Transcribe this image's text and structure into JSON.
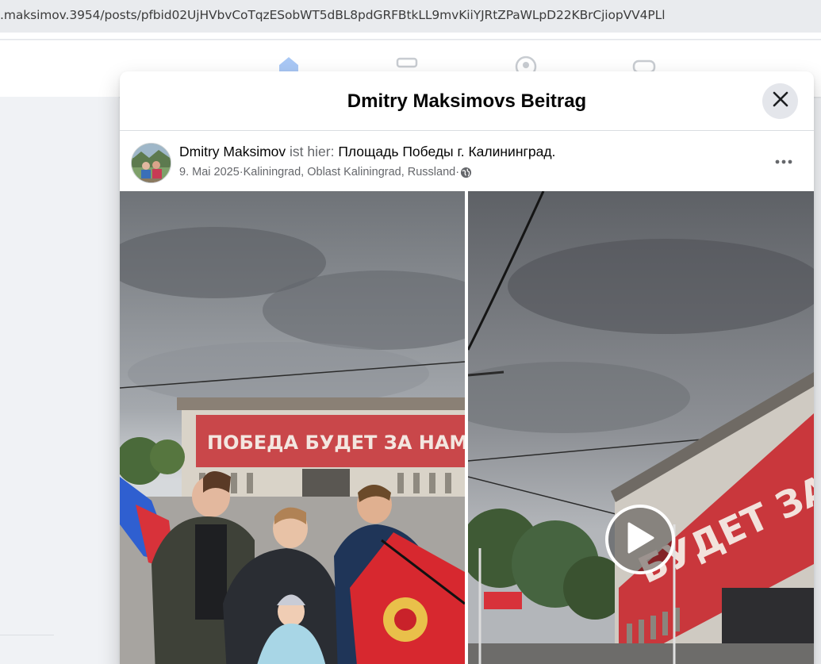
{
  "browser": {
    "url": ".maksimov.3954/posts/pfbid02UjHVbvCoTqzESobWT5dBL8pdGRFBtkLL9mvKiiYJRtZPaWLpD22KBrCjiopVV4PLl"
  },
  "header": {
    "nav_icons": [
      "home-icon",
      "marketplace-icon",
      "groups-icon",
      "gaming-icon"
    ]
  },
  "modal": {
    "title": "Dmitry Maksimovs Beitrag",
    "close_icon": "close-icon"
  },
  "post": {
    "author": "Dmitry Maksimov",
    "connector": " ist hier: ",
    "place": "Площадь Победы г. Калининград",
    "place_suffix": ".",
    "date": "9. Mai 2025",
    "separator": " · ",
    "location": "Kaliningrad, Oblast Kaliningrad, Russland",
    "audience_icon": "globe-icon",
    "more_icon": "more-options-icon"
  },
  "media": {
    "photo_banner_text": "ПОБЕДА БУДЕТ ЗА НАМИ!",
    "video_banner_text": "БУДЕТ ЗА НАМ",
    "play_icon": "play-icon"
  },
  "colors": {
    "accent": "#1877f2",
    "title_text": "#050505",
    "secondary_text": "#65676b",
    "close_bg": "#e4e6eb"
  }
}
